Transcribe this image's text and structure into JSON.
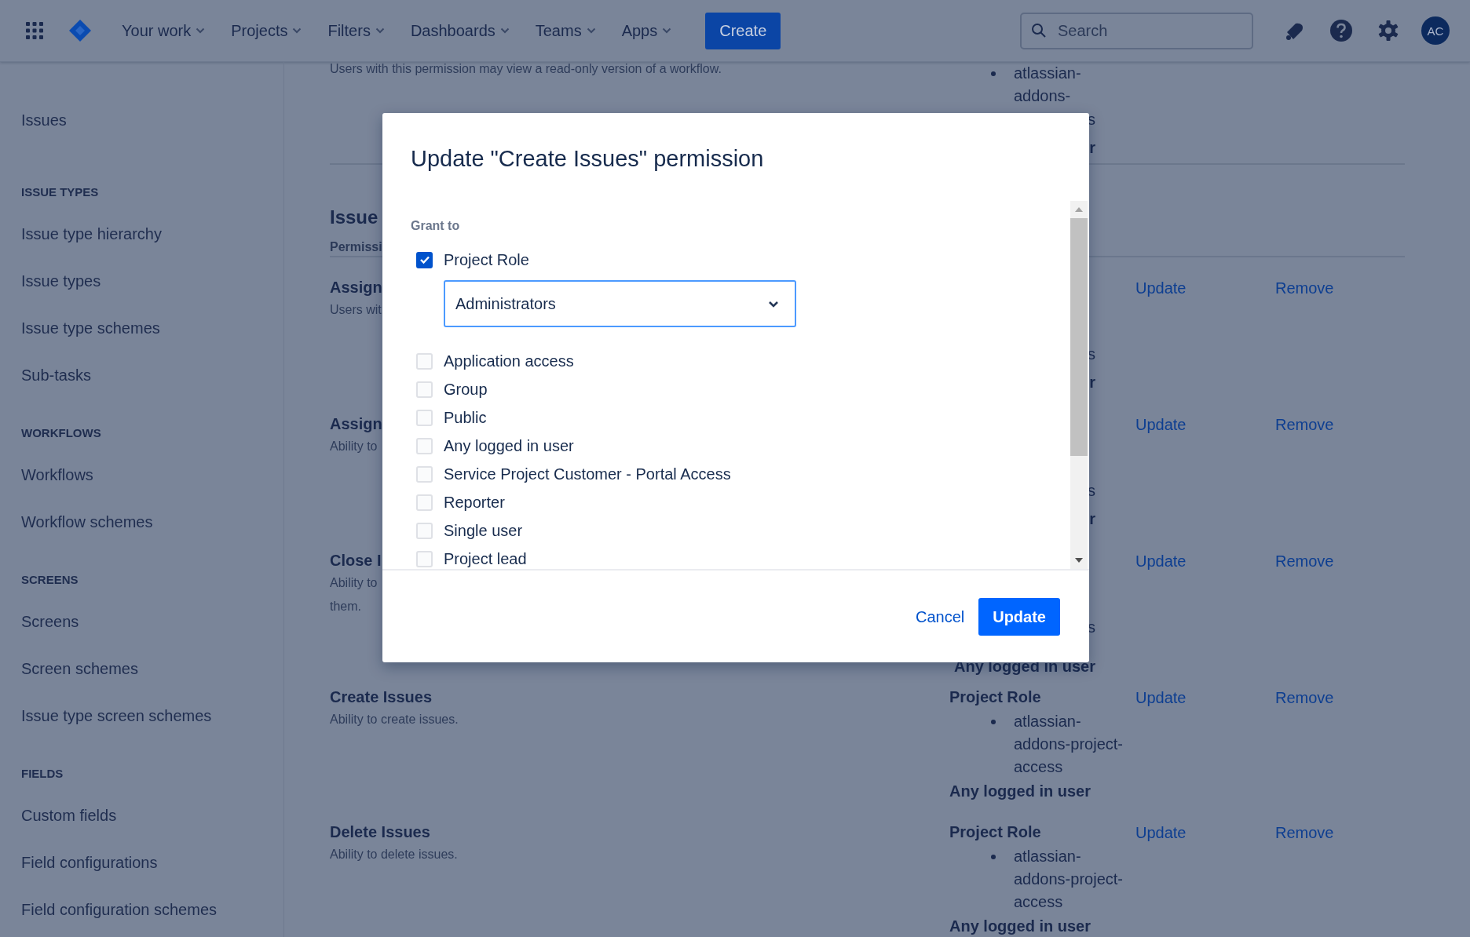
{
  "nav": {
    "items": [
      {
        "label": "Your work"
      },
      {
        "label": "Projects"
      },
      {
        "label": "Filters"
      },
      {
        "label": "Dashboards"
      },
      {
        "label": "Teams"
      },
      {
        "label": "Apps"
      }
    ],
    "create": "Create",
    "search": {
      "placeholder": "Search"
    },
    "avatar": "AC"
  },
  "sidebar": {
    "top_item": "Issues",
    "sections": [
      {
        "heading": "ISSUE TYPES",
        "items": [
          "Issue type hierarchy",
          "Issue types",
          "Issue type schemes",
          "Sub-tasks"
        ]
      },
      {
        "heading": "WORKFLOWS",
        "items": [
          "Workflows",
          "Workflow schemes"
        ]
      },
      {
        "heading": "SCREENS",
        "items": [
          "Screens",
          "Screen schemes",
          "Issue type screen schemes"
        ]
      },
      {
        "heading": "FIELDS",
        "items": [
          "Custom fields",
          "Field configurations",
          "Field configuration schemes"
        ]
      }
    ]
  },
  "content": {
    "top_row": {
      "description": "Users with this permission may view a read-only version of a workflow.",
      "grants": [
        {
          "kind": "member",
          "text": "atlassian-addons-"
        },
        {
          "kind": "tail",
          "text": "s"
        },
        {
          "kind": "tail-bold",
          "text": "r"
        }
      ]
    },
    "heading": "Issue",
    "column_header": "Permissi",
    "rows": [
      {
        "title": "Assign",
        "description": [
          "Users wit"
        ],
        "grants": [
          {
            "kind": "tail",
            "text": "s"
          },
          {
            "kind": "tail-bold",
            "text": "r"
          }
        ],
        "update": "Update",
        "remove": "Remove"
      },
      {
        "title": "Assign",
        "description": [
          "Ability to"
        ],
        "grants": [
          {
            "kind": "tail",
            "text": "s"
          },
          {
            "kind": "tail-bold",
            "text": "r"
          }
        ],
        "update": "Update",
        "remove": "Remove"
      },
      {
        "title": "Close I",
        "description": [
          "Ability to",
          "them."
        ],
        "grants": [
          {
            "kind": "tail",
            "text": "s"
          },
          {
            "kind": "tail-all",
            "text": "Any logged in user"
          }
        ],
        "update": "Update",
        "remove": "Remove"
      },
      {
        "title": "Create Issues",
        "description": [
          "Ability to create issues."
        ],
        "grants": [
          {
            "kind": "role",
            "text": "Project Role"
          },
          {
            "kind": "member",
            "text": "atlassian-addons-project-access"
          },
          {
            "kind": "all",
            "text": "Any logged in user"
          }
        ],
        "update": "Update",
        "remove": "Remove"
      },
      {
        "title": "Delete Issues",
        "description": [
          "Ability to delete issues."
        ],
        "grants": [
          {
            "kind": "role",
            "text": "Project Role"
          },
          {
            "kind": "member",
            "text": "atlassian-addons-project-access"
          },
          {
            "kind": "all",
            "text": "Any logged in user"
          }
        ],
        "update": "Update",
        "remove": "Remove"
      }
    ]
  },
  "modal": {
    "title": "Update \"Create Issues\" permission",
    "grant_label": "Grant to",
    "options": [
      {
        "label": "Project Role",
        "checked": true,
        "select": {
          "value": "Administrators"
        }
      },
      {
        "label": "Application access",
        "checked": false
      },
      {
        "label": "Group",
        "checked": false
      },
      {
        "label": "Public",
        "checked": false
      },
      {
        "label": "Any logged in user",
        "checked": false
      },
      {
        "label": "Service Project Customer - Portal Access",
        "checked": false
      },
      {
        "label": "Reporter",
        "checked": false
      },
      {
        "label": "Single user",
        "checked": false
      },
      {
        "label": "Project lead",
        "checked": false
      }
    ],
    "cancel": "Cancel",
    "submit": "Update"
  }
}
